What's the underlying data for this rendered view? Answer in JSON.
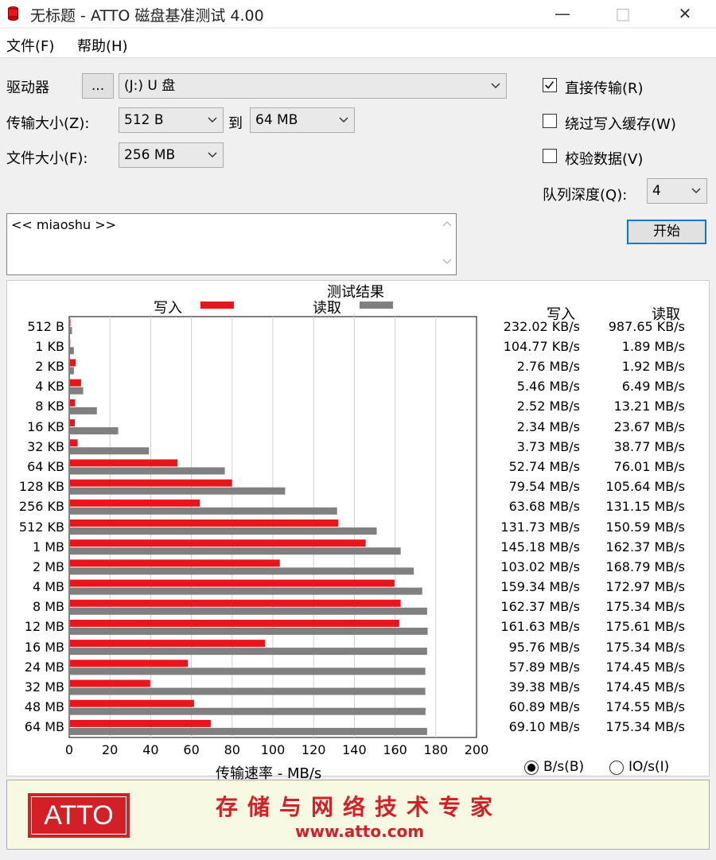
{
  "window": {
    "title": "无标题 - ATTO 磁盘基准测试 4.00"
  },
  "menu": {
    "file": "文件(F)",
    "help": "帮助(H)"
  },
  "settings": {
    "drive_label": "驱动器",
    "browse_label": "...",
    "drive_value": "(J:) U 盘",
    "transfer_label": "传输大小(Z):",
    "transfer_from": "512 B",
    "to_label": "到",
    "transfer_to": "64 MB",
    "file_size_label": "文件大小(F):",
    "file_size": "256 MB",
    "direct_io_label": "直接传输(R)",
    "direct_io_checked": true,
    "bypass_cache_label": "绕过写入缓存(W)",
    "bypass_cache_checked": false,
    "verify_label": "校验数据(V)",
    "verify_checked": false,
    "queue_label": "队列深度(Q):",
    "queue_value": "4",
    "start_label": "开始",
    "description": "<< miaoshu >>"
  },
  "results": {
    "title": "测试结果",
    "legend_write": "写入",
    "legend_read": "读取",
    "col_write": "写入",
    "col_read": "读取",
    "unit_bs": "B/s(B)",
    "unit_ios": "IO/s(I)",
    "unit_selected": "B/s",
    "write_values": [
      "232.02 KB/s",
      "104.77 KB/s",
      "2.76 MB/s",
      "5.46 MB/s",
      "2.52 MB/s",
      "2.34 MB/s",
      "3.73 MB/s",
      "52.74 MB/s",
      "79.54 MB/s",
      "63.68 MB/s",
      "131.73 MB/s",
      "145.18 MB/s",
      "103.02 MB/s",
      "159.34 MB/s",
      "162.37 MB/s",
      "161.63 MB/s",
      "95.76 MB/s",
      "57.89 MB/s",
      "39.38 MB/s",
      "60.89 MB/s",
      "69.10 MB/s"
    ],
    "read_values": [
      "987.65 KB/s",
      "1.89 MB/s",
      "1.92 MB/s",
      "6.49 MB/s",
      "13.21 MB/s",
      "23.67 MB/s",
      "38.77 MB/s",
      "76.01 MB/s",
      "105.64 MB/s",
      "131.15 MB/s",
      "150.59 MB/s",
      "162.37 MB/s",
      "168.79 MB/s",
      "172.97 MB/s",
      "175.34 MB/s",
      "175.61 MB/s",
      "175.34 MB/s",
      "174.45 MB/s",
      "174.45 MB/s",
      "174.55 MB/s",
      "175.34 MB/s"
    ]
  },
  "chart_data": {
    "type": "bar",
    "orientation": "horizontal",
    "title": "测试结果",
    "xlabel": "传输速率 - MB/s",
    "xlim": [
      0,
      200
    ],
    "x_ticks": [
      0,
      20,
      40,
      60,
      80,
      100,
      120,
      140,
      160,
      180,
      200
    ],
    "categories": [
      "512 B",
      "1 KB",
      "2 KB",
      "4 KB",
      "8 KB",
      "16 KB",
      "32 KB",
      "64 KB",
      "128 KB",
      "256 KB",
      "512 KB",
      "1 MB",
      "2 MB",
      "4 MB",
      "8 MB",
      "12 MB",
      "16 MB",
      "24 MB",
      "32 MB",
      "48 MB",
      "64 MB"
    ],
    "series": [
      {
        "name": "写入",
        "color": "#e8161b",
        "values": [
          0.23,
          0.1,
          2.76,
          5.46,
          2.52,
          2.34,
          3.73,
          52.74,
          79.54,
          63.68,
          131.73,
          145.18,
          103.02,
          159.34,
          162.37,
          161.63,
          95.76,
          57.89,
          39.38,
          60.89,
          69.1
        ]
      },
      {
        "name": "读取",
        "color": "#808080",
        "values": [
          0.99,
          1.89,
          1.92,
          6.49,
          13.21,
          23.67,
          38.77,
          76.01,
          105.64,
          131.15,
          150.59,
          162.37,
          168.79,
          172.97,
          175.34,
          175.61,
          175.34,
          174.45,
          174.45,
          174.55,
          175.34
        ]
      }
    ],
    "legend": "top"
  },
  "banner": {
    "logo": "ATTO",
    "slogan": "存储与网络技术专家",
    "url": "www.atto.com",
    "logo_color": "#d32027"
  }
}
